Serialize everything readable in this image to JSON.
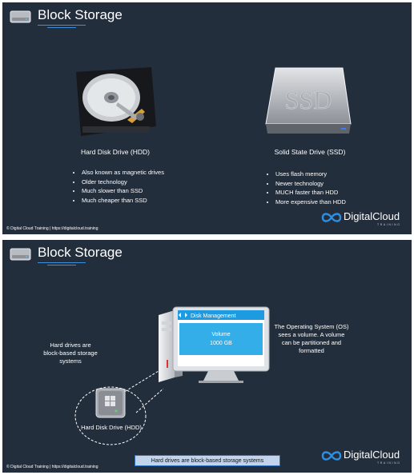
{
  "slide1": {
    "title": "Block Storage",
    "hdd": {
      "label": "Hard Disk Drive (HDD)",
      "bullets": [
        "Also known as magnetic drives",
        "Older technology",
        "Much slower than SSD",
        "Much cheaper than SSD"
      ]
    },
    "ssd": {
      "label": "Solid State Drive (SSD)",
      "device_text": "SSD",
      "bullets": [
        "Uses flash memory",
        "Newer technology",
        "MUCH faster than HDD",
        "More expensive than HDD"
      ]
    },
    "footer": "© Digital Cloud Training  |  https://digitalcloud.training",
    "brand": {
      "name": "DigitalCloud",
      "sub": "TRAINING"
    }
  },
  "slide2": {
    "title": "Block Storage",
    "left_text": "Hard drives are block-based storage systems",
    "drive_label": "Hard Disk Drive (HDD)",
    "disk_management": {
      "title": "Disk Management",
      "volume_label": "Volume",
      "volume_size": "1000 GB"
    },
    "right_text": "The Operating System (OS) sees a volume. A volume can be partitioned and formatted",
    "caption": "Hard drives are block-based storage systems",
    "footer": "© Digital Cloud Training  |  https://digitalcloud.training",
    "brand": {
      "name": "DigitalCloud",
      "sub": "TRAINING"
    }
  },
  "colors": {
    "slide_bg": "#232e3d",
    "accent": "#3c8fd8",
    "caption_bg": "#c2d3ec"
  },
  "icons": [
    "hard-drive-icon",
    "hdd-platter-icon",
    "ssd-icon",
    "computer-tower-icon",
    "monitor-icon",
    "windows-logo-icon",
    "infinity-logo-icon"
  ]
}
